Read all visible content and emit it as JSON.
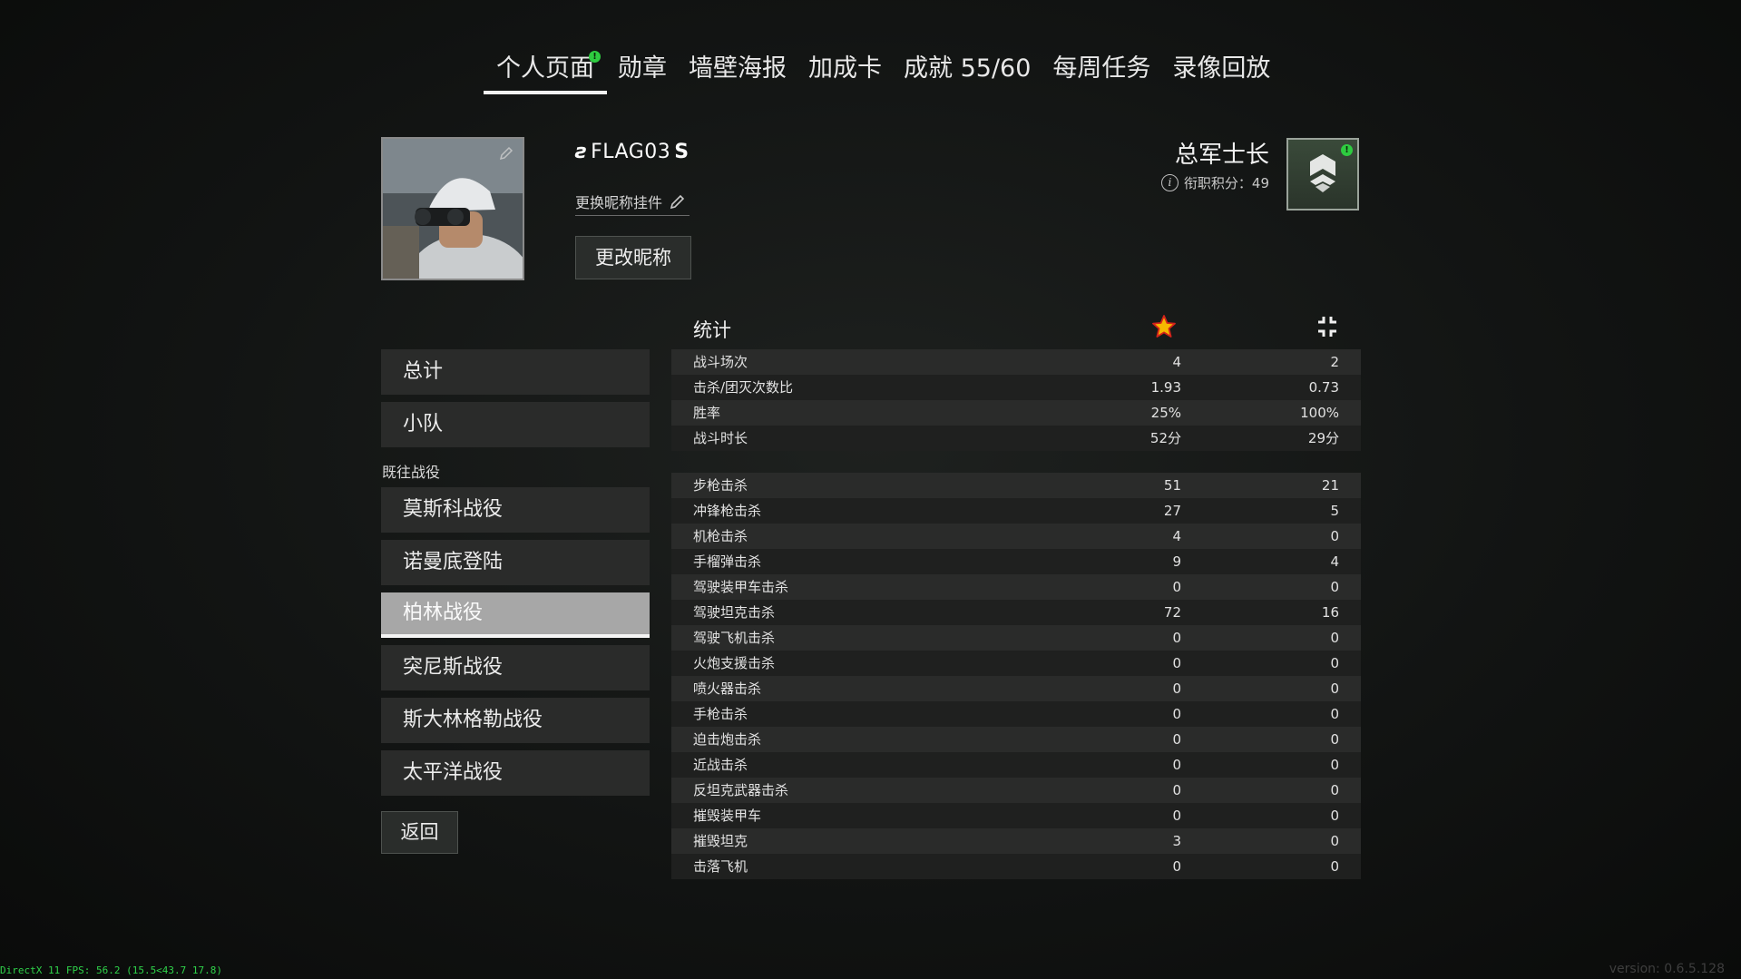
{
  "tabs": [
    {
      "label": "个人页面",
      "active": true,
      "badge": "!"
    },
    {
      "label": "勋章"
    },
    {
      "label": "墙壁海报"
    },
    {
      "label": "加成卡"
    },
    {
      "label": "成就 55/60"
    },
    {
      "label": "每周任务"
    },
    {
      "label": "录像回放"
    }
  ],
  "profile": {
    "nickname": "FLAG03",
    "nick_prefix": "ƨ",
    "nick_suffix": "S",
    "change_plate_label": "更换昵称挂件",
    "rename_button": "更改昵称",
    "rank_title": "总军士长",
    "rank_points_label": "衔职积分：49",
    "rank_badge_alert": "!"
  },
  "menu": {
    "items": [
      {
        "label": "总计"
      },
      {
        "label": "小队"
      }
    ],
    "campaigns_heading": "既往战役",
    "campaigns": [
      {
        "label": "莫斯科战役"
      },
      {
        "label": "诺曼底登陆"
      },
      {
        "label": "柏林战役",
        "selected": true
      },
      {
        "label": "突尼斯战役"
      },
      {
        "label": "斯大林格勒战役"
      },
      {
        "label": "太平洋战役"
      }
    ],
    "back_button": "返回"
  },
  "stats": {
    "title": "统计",
    "col1_icon": "star-icon",
    "col2_icon": "squad-icon",
    "accent_star": "#f5b800",
    "general": [
      {
        "label": "战斗场次",
        "v1": "4",
        "v2": "2"
      },
      {
        "label": "击杀/团灭次数比",
        "v1": "1.93",
        "v2": "0.73"
      },
      {
        "label": "胜率",
        "v1": "25%",
        "v2": "100%"
      },
      {
        "label": "战斗时长",
        "v1": "52分",
        "v2": "29分"
      }
    ],
    "kills": [
      {
        "label": "步枪击杀",
        "v1": "51",
        "v2": "21"
      },
      {
        "label": "冲锋枪击杀",
        "v1": "27",
        "v2": "5"
      },
      {
        "label": "机枪击杀",
        "v1": "4",
        "v2": "0"
      },
      {
        "label": "手榴弹击杀",
        "v1": "9",
        "v2": "4"
      },
      {
        "label": "驾驶装甲车击杀",
        "v1": "0",
        "v2": "0"
      },
      {
        "label": "驾驶坦克击杀",
        "v1": "72",
        "v2": "16"
      },
      {
        "label": "驾驶飞机击杀",
        "v1": "0",
        "v2": "0"
      },
      {
        "label": "火炮支援击杀",
        "v1": "0",
        "v2": "0"
      },
      {
        "label": "喷火器击杀",
        "v1": "0",
        "v2": "0"
      },
      {
        "label": "手枪击杀",
        "v1": "0",
        "v2": "0"
      },
      {
        "label": "迫击炮击杀",
        "v1": "0",
        "v2": "0"
      },
      {
        "label": "近战击杀",
        "v1": "0",
        "v2": "0"
      },
      {
        "label": "反坦克武器击杀",
        "v1": "0",
        "v2": "0"
      },
      {
        "label": "摧毁装甲车",
        "v1": "0",
        "v2": "0"
      },
      {
        "label": "摧毁坦克",
        "v1": "3",
        "v2": "0"
      },
      {
        "label": "击落飞机",
        "v1": "0",
        "v2": "0"
      }
    ]
  },
  "footer": {
    "fps_text": "DirectX 11 FPS: 56.2 (15.5<43.7 17.8)",
    "version_text": "version: 0.6.5.128"
  }
}
